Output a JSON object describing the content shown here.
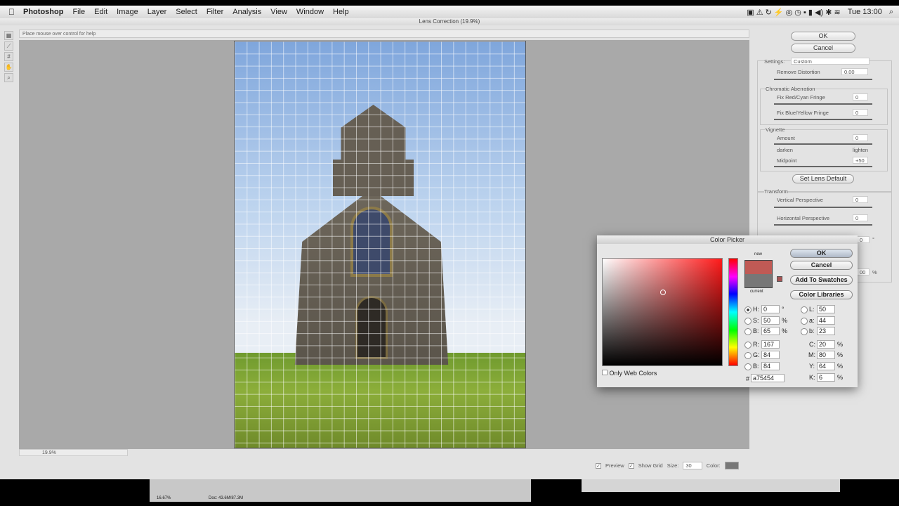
{
  "menubar": {
    "app": "Photoshop",
    "items": [
      "File",
      "Edit",
      "Image",
      "Layer",
      "Select",
      "Filter",
      "Analysis",
      "View",
      "Window",
      "Help"
    ],
    "clock": "Tue 13:00"
  },
  "window": {
    "title": "Lens Correction (19.9%)",
    "help": "Place mouse over control for help",
    "zoom": "19.9%"
  },
  "panel": {
    "ok": "OK",
    "cancel": "Cancel",
    "settings_label": "Settings:",
    "settings_value": "Custom",
    "remove_distortion": "Remove Distortion",
    "remove_distortion_value": "0.00",
    "chromatic": "Chromatic Aberration",
    "red_cyan": "Fix Red/Cyan Fringe",
    "red_cyan_value": "0",
    "blue_yellow": "Fix Blue/Yellow Fringe",
    "blue_yellow_value": "0",
    "vignette": "Vignette",
    "amount": "Amount",
    "amount_value": "0",
    "darken": "darken",
    "lighten": "lighten",
    "midpoint": "Midpoint",
    "midpoint_value": "+50",
    "set_default": "Set Lens Default",
    "transform": "Transform",
    "vertical": "Vertical Perspective",
    "vertical_value": "0",
    "horizontal": "Horizontal Perspective",
    "horizontal_value": "0",
    "angle_value": "0",
    "angle_unit": "°",
    "scale_value": "00",
    "scale_unit": "%"
  },
  "bottom": {
    "preview": "Preview",
    "show_grid": "Show Grid",
    "size_label": "Size:",
    "size_value": "30",
    "color_label": "Color:",
    "grid_color": "#777777"
  },
  "doc": {
    "zoom": "16.67%",
    "info": "Doc: 43.6M/87.3M"
  },
  "color_picker": {
    "title": "Color Picker",
    "new": "new",
    "current": "current",
    "new_color": "#c05a55",
    "current_color": "#777777",
    "ok": "OK",
    "cancel": "Cancel",
    "add_swatches": "Add To Swatches",
    "libraries": "Color Libraries",
    "only_web": "Only Web Colors",
    "H": "0",
    "S": "50",
    "B": "65",
    "R": "167",
    "G": "84",
    "Bl": "84",
    "L": "50",
    "a": "44",
    "b": "23",
    "C": "20",
    "M": "80",
    "Y": "64",
    "K": "6",
    "hex": "a75454",
    "deg": "°",
    "pct": "%"
  }
}
